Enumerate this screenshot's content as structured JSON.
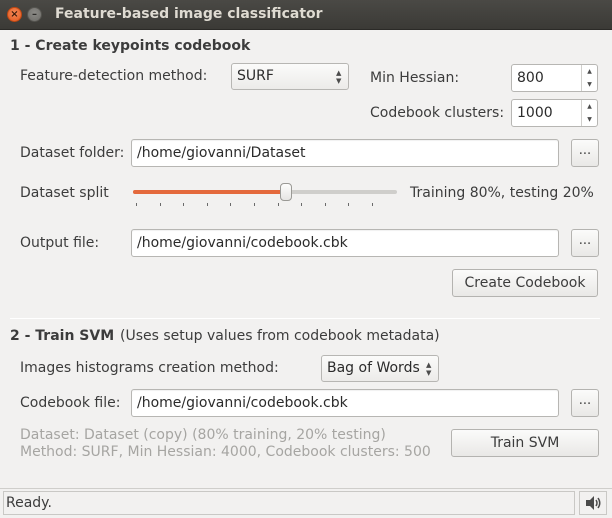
{
  "window": {
    "title": "Feature-based image classificator",
    "close_glyph": "×",
    "minimize_glyph": "–"
  },
  "codebook_section": {
    "title": "1 - Create keypoints codebook",
    "feature_method_label": "Feature-detection method:",
    "feature_method_value": "SURF",
    "min_hessian_label": "Min Hessian:",
    "min_hessian_value": "800",
    "codebook_clusters_label": "Codebook clusters:",
    "codebook_clusters_value": "1000",
    "dataset_folder_label": "Dataset folder:",
    "dataset_folder_value": "/home/giovanni/Dataset",
    "browse_label": "...",
    "dataset_split_label": "Dataset split",
    "dataset_split_fraction": 0.8,
    "dataset_split_text": "Training 80%, testing 20%",
    "output_file_label": "Output file:",
    "output_file_value": "/home/giovanni/codebook.cbk",
    "create_button_label": "Create Codebook"
  },
  "svm_section": {
    "title": "2 - Train SVM",
    "subtitle": "(Uses setup values from codebook metadata)",
    "histogram_method_label": "Images histograms creation method:",
    "histogram_method_value": "Bag of Words",
    "codebook_file_label": "Codebook file:",
    "codebook_file_value": "/home/giovanni/codebook.cbk",
    "browse_label": "...",
    "info_dataset": "Dataset: Dataset (copy) (80% training, 20% testing)",
    "info_method": "Method: SURF, Min Hessian: 4000, Codebook clusters: 500",
    "train_button_label": "Train SVM"
  },
  "statusbar": {
    "text": "Ready.",
    "icon": "speaker-icon"
  },
  "colors": {
    "accent": "#e4693c",
    "titlebar": "#3c3b37"
  }
}
